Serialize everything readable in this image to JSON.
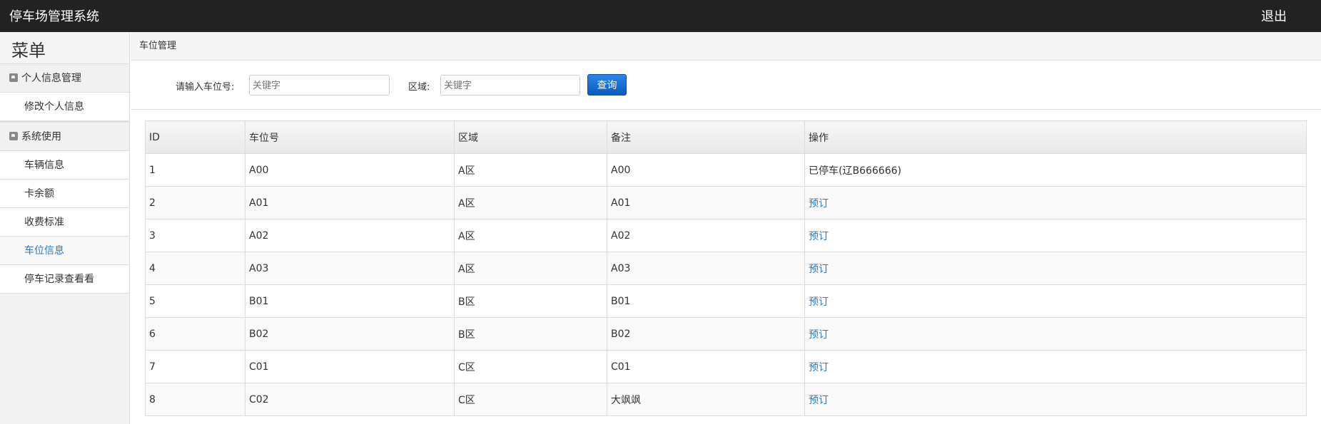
{
  "app": {
    "title": "停车场管理系统",
    "logout": "退出"
  },
  "sidebar": {
    "menu_title": "菜单",
    "groups": [
      {
        "label": "个人信息管理",
        "items": [
          "修改个人信息"
        ]
      },
      {
        "label": "系统使用",
        "items": [
          "车辆信息",
          "卡余额",
          "收费标准",
          "车位信息",
          "停车记录查看看"
        ]
      }
    ],
    "active_item": "车位信息"
  },
  "breadcrumb": "车位管理",
  "search": {
    "slot_label": "请输入车位号:",
    "slot_placeholder": "关键字",
    "area_label": "区域:",
    "area_placeholder": "关键字",
    "button": "查询"
  },
  "table": {
    "headers": [
      "ID",
      "车位号",
      "区域",
      "备注",
      "操作"
    ],
    "rows": [
      {
        "id": "1",
        "slot": "A00",
        "area": "A区",
        "note": "A00",
        "action": "已停车(辽B666666)",
        "action_link": false
      },
      {
        "id": "2",
        "slot": "A01",
        "area": "A区",
        "note": "A01",
        "action": "预订",
        "action_link": true
      },
      {
        "id": "3",
        "slot": "A02",
        "area": "A区",
        "note": "A02",
        "action": "预订",
        "action_link": true
      },
      {
        "id": "4",
        "slot": "A03",
        "area": "A区",
        "note": "A03",
        "action": "预订",
        "action_link": true
      },
      {
        "id": "5",
        "slot": "B01",
        "area": "B区",
        "note": "B01",
        "action": "预订",
        "action_link": true
      },
      {
        "id": "6",
        "slot": "B02",
        "area": "B区",
        "note": "B02",
        "action": "预订",
        "action_link": true
      },
      {
        "id": "7",
        "slot": "C01",
        "area": "C区",
        "note": "C01",
        "action": "预订",
        "action_link": true
      },
      {
        "id": "8",
        "slot": "C02",
        "area": "C区",
        "note": "大飒飒",
        "action": "预订",
        "action_link": true
      }
    ]
  },
  "colors": {
    "topbar": "#222222",
    "link": "#337ab7",
    "button": "#1a73d6"
  }
}
